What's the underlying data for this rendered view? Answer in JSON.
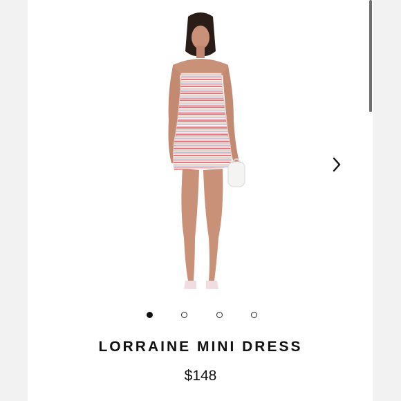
{
  "product": {
    "name": "LORRAINE MINI DRESS",
    "price": "$148",
    "image_icon": "model-wearing-striped-strapless-dress"
  },
  "carousel": {
    "total_slides": 4,
    "active_index": 0,
    "next_icon": "chevron-right-icon"
  },
  "colors": {
    "background": "#ffffff",
    "outer": "#f2f2f2",
    "text": "#111111",
    "stripe_red": "#e07a82",
    "stripe_peach": "#f3c8b4",
    "stripe_blue": "#b9c3d8"
  }
}
